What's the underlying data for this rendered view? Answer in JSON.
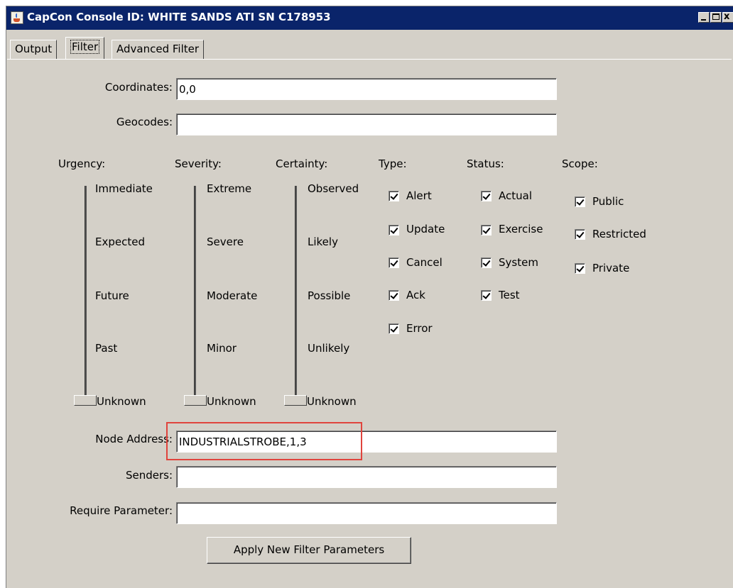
{
  "window": {
    "title": "CapCon Console ID: WHITE SANDS ATI SN C178953",
    "minimize": "_",
    "maximize": "□",
    "close": "x"
  },
  "tabs": [
    {
      "label": "Output",
      "active": false
    },
    {
      "label": "Filter",
      "active": true
    },
    {
      "label": "Advanced Filter",
      "active": false
    }
  ],
  "form": {
    "coordinates": {
      "label": "Coordinates:",
      "value": "0,0"
    },
    "geocodes": {
      "label": "Geocodes:",
      "value": ""
    },
    "node_address": {
      "label": "Node Address:",
      "value": "INDUSTRIALSTROBE,1,3"
    },
    "senders": {
      "label": "Senders:",
      "value": ""
    },
    "require_parameter": {
      "label": "Require Parameter:",
      "value": ""
    }
  },
  "sliders": {
    "urgency": {
      "label": "Urgency:",
      "ticks": [
        "Immediate",
        "Expected",
        "Future",
        "Past",
        "Unknown"
      ],
      "selected": "Unknown"
    },
    "severity": {
      "label": "Severity:",
      "ticks": [
        "Extreme",
        "Severe",
        "Moderate",
        "Minor",
        "Unknown"
      ],
      "selected": "Unknown"
    },
    "certainty": {
      "label": "Certainty:",
      "ticks": [
        "Observed",
        "Likely",
        "Possible",
        "Unlikely",
        "Unknown"
      ],
      "selected": "Unknown"
    }
  },
  "checkgroups": {
    "type": {
      "label": "Type:",
      "items": [
        {
          "label": "Alert",
          "checked": true
        },
        {
          "label": "Update",
          "checked": true
        },
        {
          "label": "Cancel",
          "checked": true
        },
        {
          "label": "Ack",
          "checked": true
        },
        {
          "label": "Error",
          "checked": true
        }
      ]
    },
    "status": {
      "label": "Status:",
      "items": [
        {
          "label": "Actual",
          "checked": true
        },
        {
          "label": "Exercise",
          "checked": true
        },
        {
          "label": "System",
          "checked": true
        },
        {
          "label": "Test",
          "checked": true
        }
      ]
    },
    "scope": {
      "label": "Scope:",
      "items": [
        {
          "label": "Public",
          "checked": true
        },
        {
          "label": "Restricted",
          "checked": true
        },
        {
          "label": "Private",
          "checked": true
        }
      ]
    }
  },
  "apply_button": "Apply New Filter Parameters",
  "colors": {
    "titlebar": "#0a246a",
    "panel": "#d4d0c8",
    "highlight_box": "#e0443d"
  }
}
